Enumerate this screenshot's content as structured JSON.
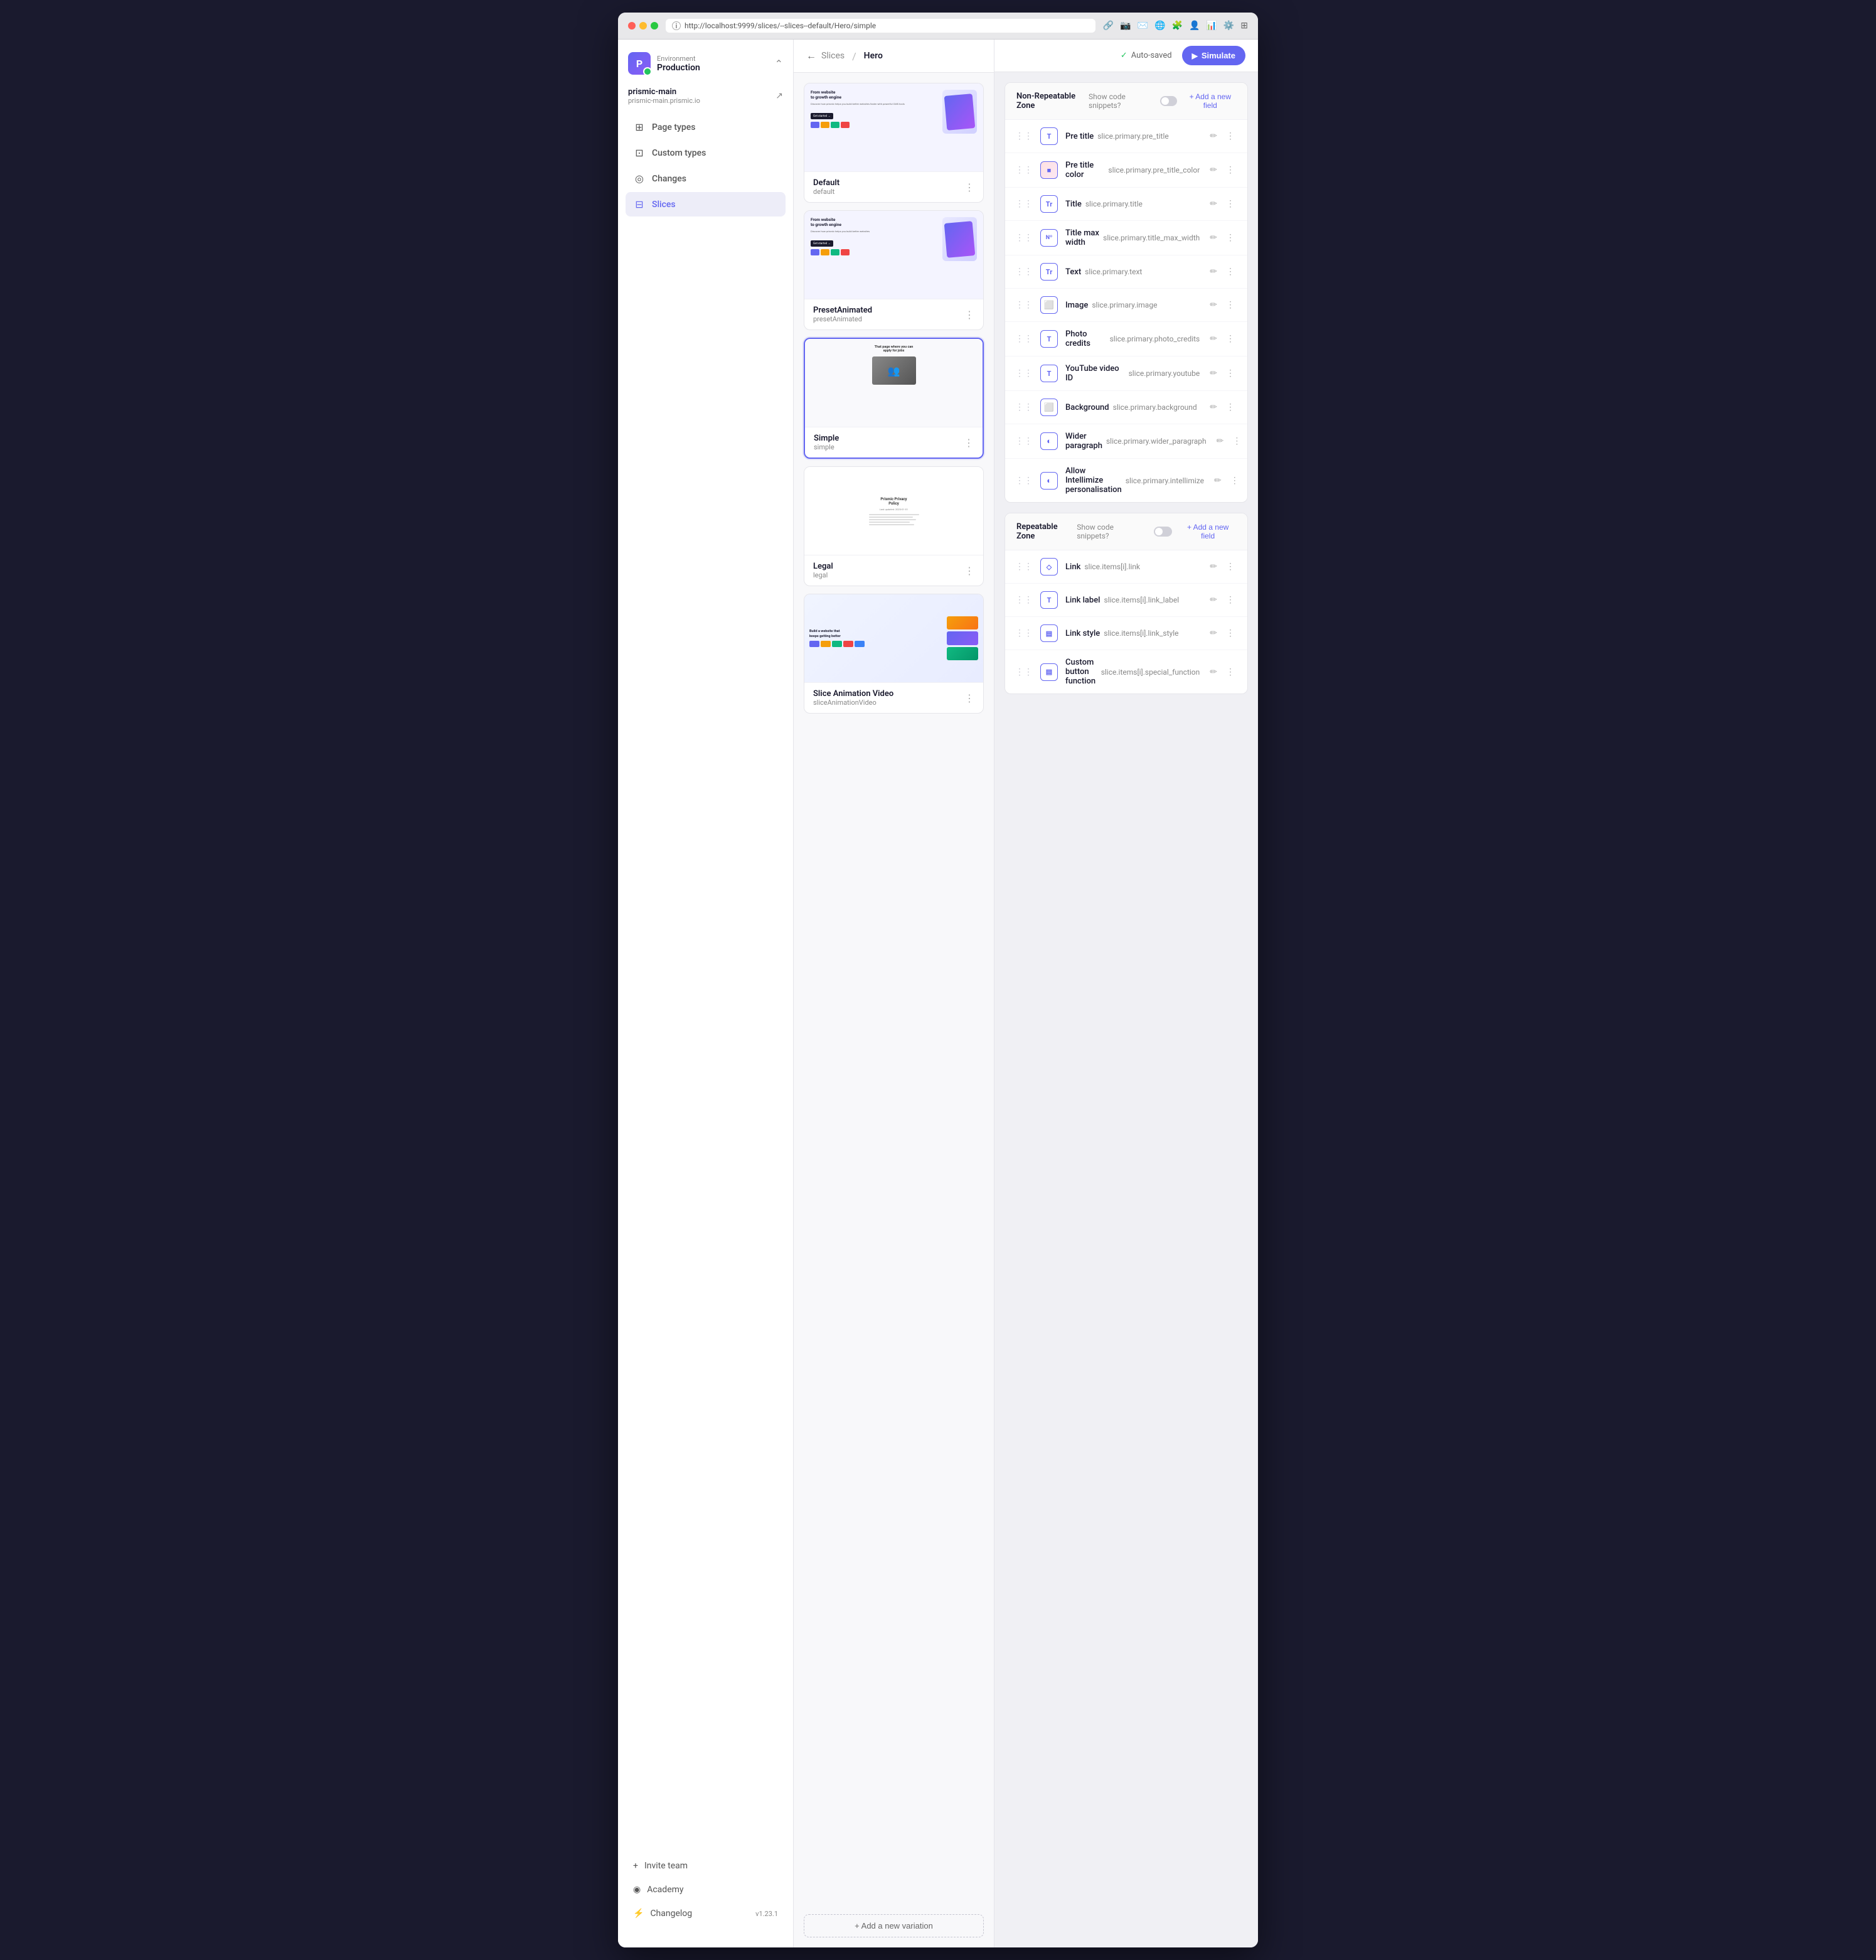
{
  "browser": {
    "url": "http://localhost:9999/slices/--slices--default/Hero/simple"
  },
  "header": {
    "auto_saved": "Auto-saved",
    "simulate_label": "Simulate",
    "back_arrow": "←",
    "breadcrumb_slices": "Slices",
    "breadcrumb_sep": "/",
    "breadcrumb_current": "Hero"
  },
  "sidebar": {
    "environment_label": "Environment",
    "environment_value": "Production",
    "project_name": "prismic-main",
    "project_domain": "prismic-main.prismic.io",
    "nav_items": [
      {
        "id": "page-types",
        "label": "Page types",
        "icon": "⊞"
      },
      {
        "id": "custom-types",
        "label": "Custom types",
        "icon": "⊡"
      },
      {
        "id": "changes",
        "label": "Changes",
        "icon": "◎"
      },
      {
        "id": "slices",
        "label": "Slices",
        "icon": "⊟",
        "active": true
      }
    ],
    "bottom_items": [
      {
        "id": "invite-team",
        "label": "Invite team",
        "icon": "+"
      },
      {
        "id": "academy",
        "label": "Academy",
        "icon": "◉"
      },
      {
        "id": "changelog",
        "label": "Changelog",
        "icon": "⚡",
        "version": "v1.23.1"
      }
    ]
  },
  "slices": {
    "add_variation_label": "+ Add a new variation",
    "items": [
      {
        "id": "default",
        "name": "Default",
        "variant": "default",
        "preview_type": "default"
      },
      {
        "id": "preset-animated",
        "name": "PresetAnimated",
        "variant": "presetAnimated",
        "preview_type": "animated"
      },
      {
        "id": "simple",
        "name": "Simple",
        "variant": "simple",
        "preview_type": "simple",
        "selected": true
      },
      {
        "id": "legal",
        "name": "Legal",
        "variant": "legal",
        "preview_type": "legal"
      },
      {
        "id": "slice-animation-video",
        "name": "Slice Animation Video",
        "variant": "sliceAnimationVideo",
        "preview_type": "animation-video"
      }
    ]
  },
  "non_repeatable_zone": {
    "title": "Non-Repeatable Zone",
    "show_code_snippets": "Show code snippets?",
    "add_field_label": "+ Add a new field",
    "fields": [
      {
        "id": "pre-title",
        "label": "Pre title",
        "api_id": "slice.primary.pre_title",
        "type": "T"
      },
      {
        "id": "pre-title-color",
        "label": "Pre title color",
        "api_id": "slice.primary.pre_title_color",
        "type": "C"
      },
      {
        "id": "title",
        "label": "Title",
        "api_id": "slice.primary.title",
        "type": "Tr"
      },
      {
        "id": "title-max-width",
        "label": "Title max width",
        "api_id": "slice.primary.title_max_width",
        "type": "Nº"
      },
      {
        "id": "text",
        "label": "Text",
        "api_id": "slice.primary.text",
        "type": "Tr"
      },
      {
        "id": "image",
        "label": "Image",
        "api_id": "slice.primary.image",
        "type": "⬜"
      },
      {
        "id": "photo-credits",
        "label": "Photo credits",
        "api_id": "slice.primary.photo_credits",
        "type": "T"
      },
      {
        "id": "youtube-video-id",
        "label": "YouTube video ID",
        "api_id": "slice.primary.youtube",
        "type": "T"
      },
      {
        "id": "background",
        "label": "Background",
        "api_id": "slice.primary.background",
        "type": "⬜"
      },
      {
        "id": "wider-paragraph",
        "label": "Wider paragraph",
        "api_id": "slice.primary.wider_paragraph",
        "type": "◐"
      },
      {
        "id": "allow-intellimize",
        "label": "Allow Intellimize personalisation",
        "api_id": "slice.primary.intellimize",
        "type": "◐"
      }
    ]
  },
  "repeatable_zone": {
    "title": "Repeatable Zone",
    "show_code_snippets": "Show code snippets?",
    "add_field_label": "+ Add a new field",
    "fields": [
      {
        "id": "link",
        "label": "Link",
        "api_id": "slice.items[i].link",
        "type": "◇"
      },
      {
        "id": "link-label",
        "label": "Link label",
        "api_id": "slice.items[i].link_label",
        "type": "T"
      },
      {
        "id": "link-style",
        "label": "Link style",
        "api_id": "slice.items[i].link_style",
        "type": "▤"
      },
      {
        "id": "custom-button-function",
        "label": "Custom button function",
        "api_id": "slice.items[i].special_function",
        "type": "▤"
      }
    ]
  }
}
